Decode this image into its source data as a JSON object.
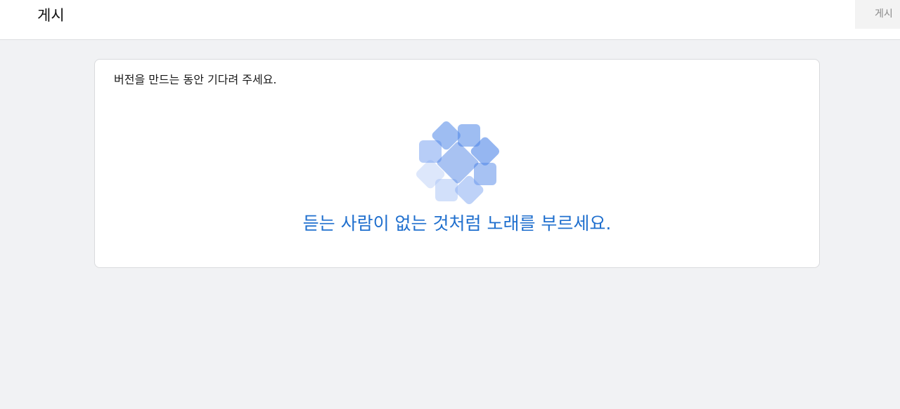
{
  "header": {
    "title": "게시",
    "publish_label": "게시"
  },
  "card": {
    "message": "버전을 만드는 동안 기다려 주세요.",
    "quote": "듣는 사람이 없는 것처럼 노래를 부르세요.",
    "spinner_icon": "pinwheel-loading-icon"
  },
  "colors": {
    "accent": "#1f6fce",
    "spinner": "#4f86e8",
    "background": "#f1f2f4"
  }
}
